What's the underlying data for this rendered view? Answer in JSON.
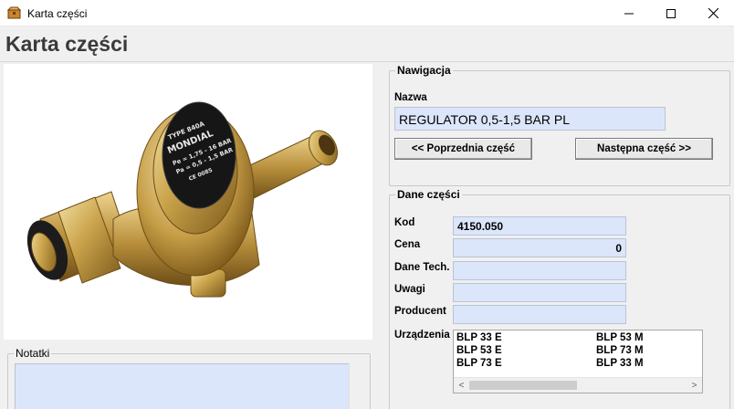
{
  "window": {
    "title": "Karta części",
    "app_icon": "app-box-icon",
    "controls": [
      "minimize-icon",
      "maximize-icon",
      "close-icon"
    ]
  },
  "header": {
    "title": "Karta części"
  },
  "photo": {
    "gauge_text": [
      "TYPE 840A",
      "MONDIAL",
      "Pe = 1,75 - 16 BAR",
      "Pa = 0,5 - 1,5 BAR",
      "CE 0085"
    ]
  },
  "nawigacja": {
    "legend": "Nawigacja",
    "name_label": "Nazwa",
    "name_value": "REGULATOR 0,5-1,5 BAR PL",
    "prev_button": "<< Poprzednia część",
    "next_button": "Następna część >>"
  },
  "dane": {
    "legend": "Dane części",
    "fields": [
      {
        "label": "Kod",
        "value": "4150.050"
      },
      {
        "label": "Cena",
        "value": "0"
      },
      {
        "label": "Dane Tech.",
        "value": ""
      },
      {
        "label": "Uwagi",
        "value": ""
      },
      {
        "label": "Producent",
        "value": ""
      }
    ],
    "urzadzenia_label": "Urządzenia",
    "urzadzenia": [
      [
        "BLP 33 E",
        "BLP 53 M"
      ],
      [
        "BLP 53 E",
        "BLP 73 M"
      ],
      [
        "BLP 73 E",
        "BLP 33 M"
      ]
    ],
    "scroll_left": "<",
    "scroll_right": ">"
  },
  "notatki": {
    "legend": "Notatki",
    "value": ""
  },
  "colors": {
    "field_bg": "#dce6fa",
    "window_bg": "#f0f0f0"
  }
}
